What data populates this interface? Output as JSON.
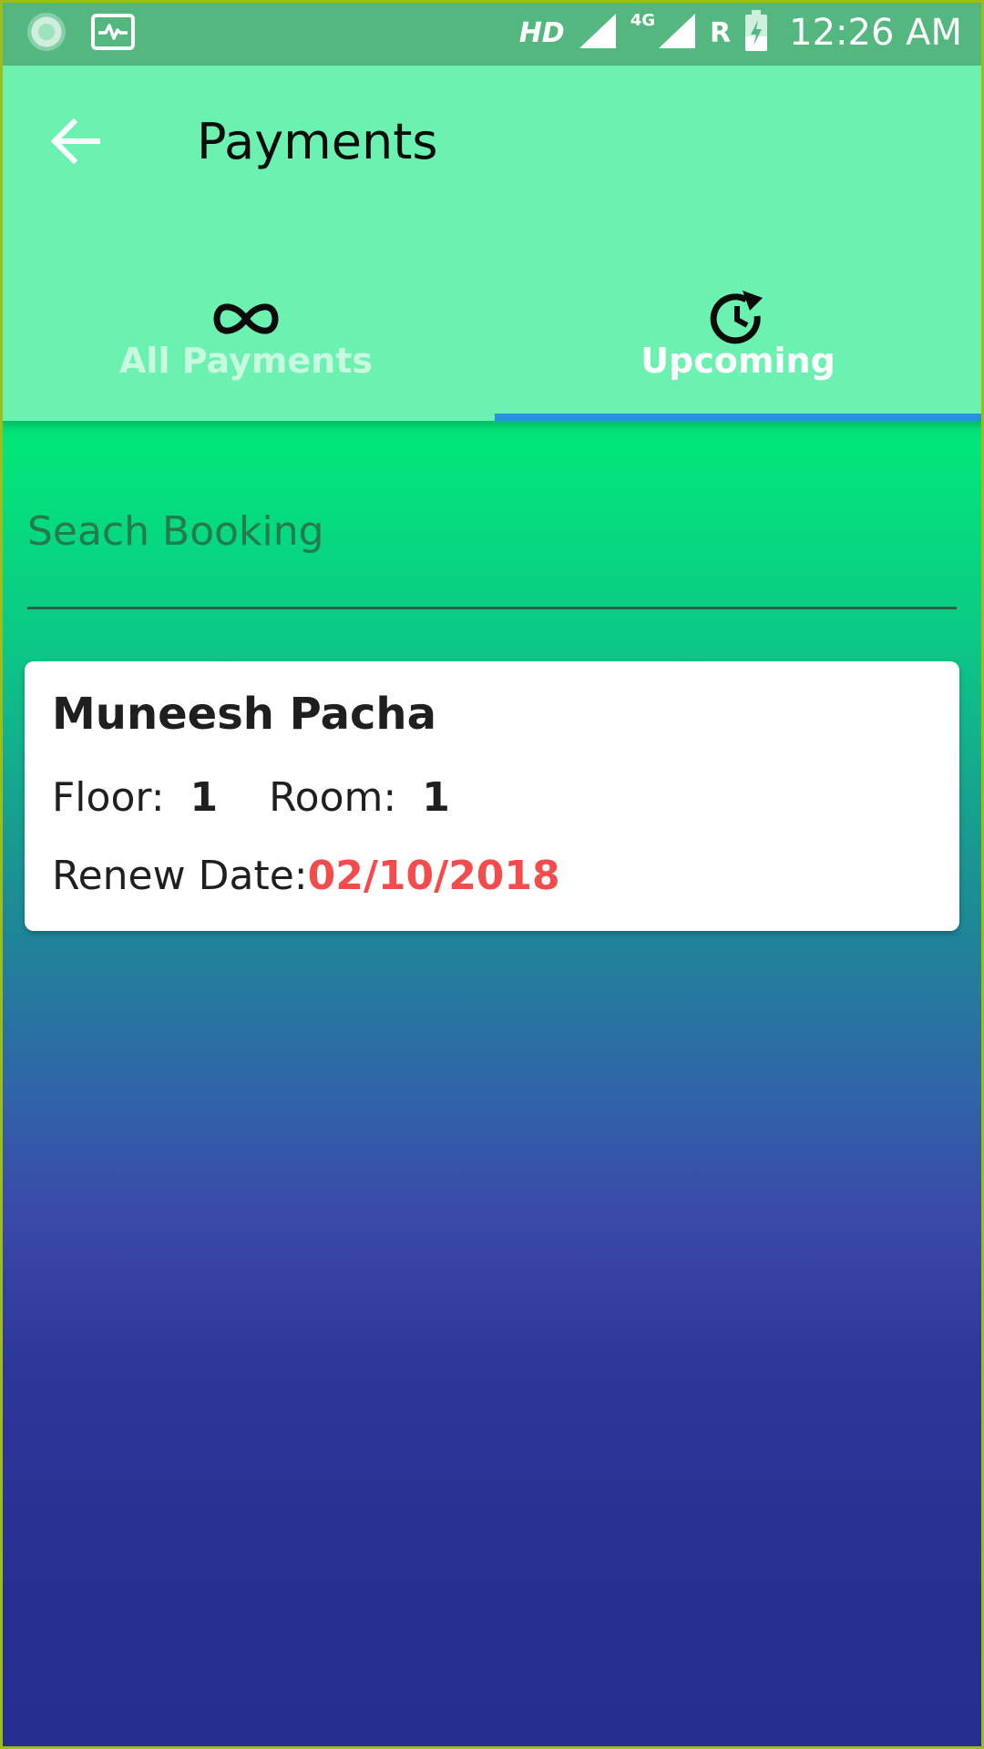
{
  "status_bar": {
    "network_hd": "HD",
    "network_4g": "4G",
    "roaming": "R",
    "time": "12:26 AM"
  },
  "app_bar": {
    "title": "Payments",
    "back_icon": "arrow-left-icon",
    "background": "#6cf2b0"
  },
  "tabs": [
    {
      "label": "All Payments",
      "icon": "infinity-icon",
      "active": false
    },
    {
      "label": "Upcoming",
      "icon": "clock-restore-icon",
      "active": true
    }
  ],
  "search": {
    "placeholder": "Seach Booking",
    "value": ""
  },
  "bookings": [
    {
      "name": "Muneesh Pacha",
      "floor_label": "Floor:",
      "floor": "1",
      "room_label": "Room:",
      "room": "1",
      "renew_label": "Renew Date:",
      "renew_date": "02/10/2018"
    }
  ],
  "colors": {
    "accent_indicator": "#2b8fdf",
    "renew_date": "#f44c4c",
    "status_bar": "#53b77f"
  }
}
